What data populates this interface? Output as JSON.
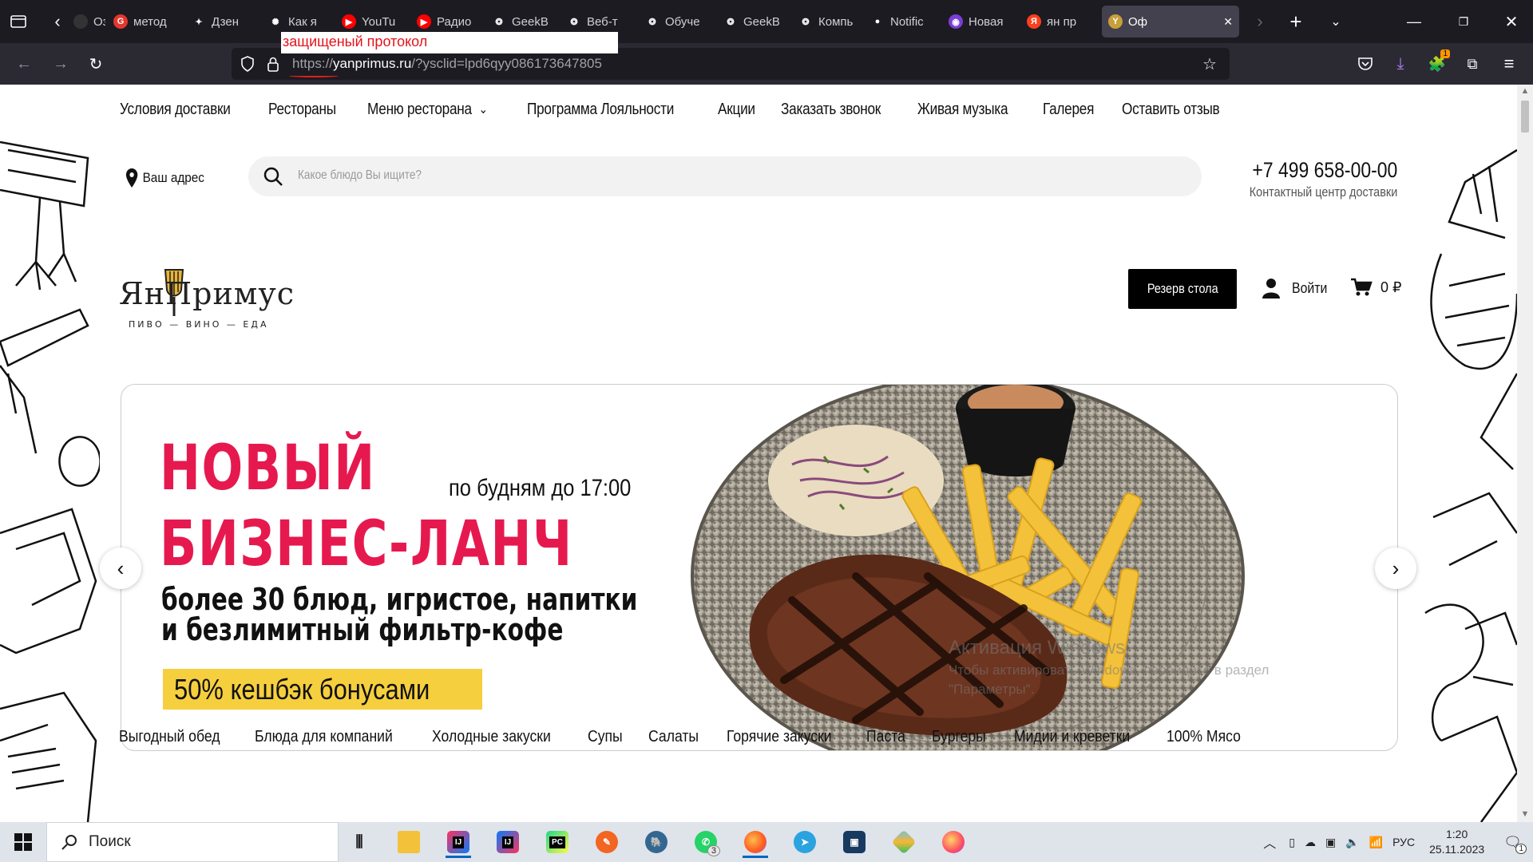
{
  "browser": {
    "tabs": [
      {
        "label": "Озон",
        "fav_color": "#333",
        "fav_glyph": ""
      },
      {
        "label": "метод",
        "fav_color": "#e4372c",
        "fav_glyph": "G"
      },
      {
        "label": "Дзен",
        "fav_color": "#1c1b22",
        "fav_glyph": "✦"
      },
      {
        "label": "Как я",
        "fav_color": "#1c1b22",
        "fav_glyph": "✺"
      },
      {
        "label": "YouTu",
        "fav_color": "#ff0000",
        "fav_glyph": "▶"
      },
      {
        "label": "Радио",
        "fav_color": "#ff0000",
        "fav_glyph": "▶"
      },
      {
        "label": "GeekB",
        "fav_color": "#1c1b22",
        "fav_glyph": "❂"
      },
      {
        "label": "Веб-т",
        "fav_color": "#1c1b22",
        "fav_glyph": "❂"
      },
      {
        "label": "Обуче",
        "fav_color": "#1c1b22",
        "fav_glyph": "❂"
      },
      {
        "label": "GeekB",
        "fav_color": "#1c1b22",
        "fav_glyph": "❂"
      },
      {
        "label": "Компь",
        "fav_color": "#1c1b22",
        "fav_glyph": "❂"
      },
      {
        "label": "Notific",
        "fav_color": "#1c1b22",
        "fav_glyph": "●"
      },
      {
        "label": "Новая",
        "fav_color": "#7b3ed6",
        "fav_glyph": "◉"
      },
      {
        "label": "ян пр",
        "fav_color": "#fc3f1d",
        "fav_glyph": "Я"
      },
      {
        "label": "Оф",
        "fav_color": "#c8a03a",
        "fav_glyph": "Y"
      }
    ],
    "url_scheme": "https://",
    "url_host": "yanprimus.ru",
    "url_rest": "/?ysclid=lpd6qyy086173647805",
    "annotation": "защищеный протокол",
    "downloads_badge": "1"
  },
  "site": {
    "menu": [
      "Условия доставки",
      "Рестораны",
      "Меню ресторана",
      "Программа Лояльности",
      "Акции",
      "Заказать звонок",
      "Живая музыка",
      "Галерея",
      "Оставить отзыв"
    ],
    "address_label": "Ваш адрес",
    "search_placeholder": "Какое блюдо Вы ищите?",
    "phone": "+7 499 658-00-00",
    "phone_sub": "Контактный центр доставки",
    "logo_name": "ЯнПримус",
    "logo_tagline": "ПИВО — ВИНО — ЕДА",
    "reserve_button": "Резерв стола",
    "login_label": "Войти",
    "cart_total": "0 ₽",
    "banner": {
      "title_line1": "НОВЫЙ",
      "title_line2": "БИЗНЕС-ЛАНЧ",
      "schedule": "по будням до 17:00",
      "desc_line1": "более 30 блюд, игристое, напитки",
      "desc_line2": "и безлимитный фильтр-кофе",
      "badge": "50% кешбэк бонусами"
    },
    "categories": [
      "Выгодный обед",
      "Блюда для компаний",
      "Холодные закуски",
      "Супы",
      "Салаты",
      "Горячие закуски",
      "Паста",
      "Бургеры",
      "Мидии и креветки",
      "100% Мясо"
    ]
  },
  "windows": {
    "watermark_title": "Активация Windows",
    "watermark_sub1": "Чтобы активировать Windows, перейдите в раздел",
    "watermark_sub2": "\"Параметры\".",
    "search_label": "Поиск",
    "lang": "РУС",
    "time": "1:20",
    "date": "25.11.2023",
    "whatsapp_badge": "3",
    "notif_badge": "1"
  },
  "colors": {
    "accent_red": "#e6194f",
    "badge_yellow": "#f6cf3e",
    "browser_dark": "#1c1b22"
  }
}
